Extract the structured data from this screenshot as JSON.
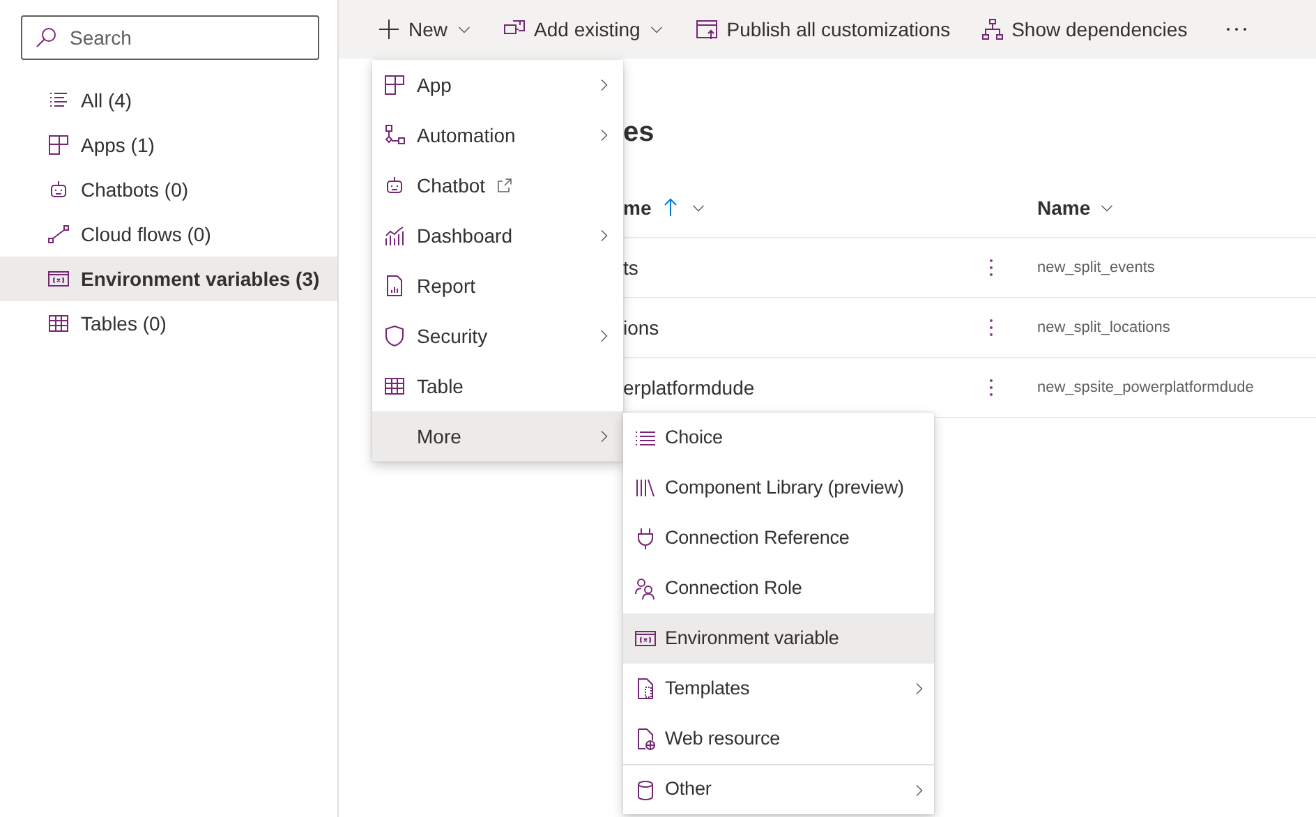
{
  "sidebar": {
    "search": {
      "placeholder": "Search"
    },
    "items": [
      {
        "label": "All (4)",
        "selected": false
      },
      {
        "label": "Apps (1)",
        "selected": false
      },
      {
        "label": "Chatbots (0)",
        "selected": false
      },
      {
        "label": "Cloud flows (0)",
        "selected": false
      },
      {
        "label": "Environment variables (3)",
        "selected": true
      },
      {
        "label": "Tables (0)",
        "selected": false
      }
    ]
  },
  "toolbar": {
    "items": [
      {
        "label": "New",
        "dropdown": true
      },
      {
        "label": "Add existing",
        "dropdown": true
      },
      {
        "label": "Publish all customizations",
        "dropdown": false
      },
      {
        "label": "Show dependencies",
        "dropdown": false
      }
    ]
  },
  "content": {
    "heading": "es",
    "columns": [
      {
        "label": "me",
        "sorted_ascending": true
      },
      {
        "label": "Name",
        "sorted_ascending": false
      }
    ],
    "rows": [
      {
        "column_1": "ts",
        "column_2": "new_split_events"
      },
      {
        "column_1": "ions",
        "column_2": "new_split_locations"
      },
      {
        "column_1": "erplatformdude",
        "column_2": "new_spsite_powerplatformdude"
      }
    ]
  },
  "new_menu": {
    "items": [
      {
        "label": "App",
        "submenu": true,
        "external": false,
        "selected": false
      },
      {
        "label": "Automation",
        "submenu": true,
        "external": false,
        "selected": false
      },
      {
        "label": "Chatbot",
        "submenu": false,
        "external": true,
        "selected": false
      },
      {
        "label": "Dashboard",
        "submenu": true,
        "external": false,
        "selected": false
      },
      {
        "label": "Report",
        "submenu": false,
        "external": false,
        "selected": false
      },
      {
        "label": "Security",
        "submenu": true,
        "external": false,
        "selected": false
      },
      {
        "label": "Table",
        "submenu": false,
        "external": false,
        "selected": false
      },
      {
        "label": "More",
        "submenu": true,
        "external": false,
        "selected": true
      }
    ]
  },
  "more_menu": {
    "items": [
      {
        "label": "Choice",
        "submenu": false,
        "separator_before": false,
        "selected": false
      },
      {
        "label": "Component Library (preview)",
        "submenu": false,
        "separator_before": false,
        "selected": false
      },
      {
        "label": "Connection Reference",
        "submenu": false,
        "separator_before": false,
        "selected": false
      },
      {
        "label": "Connection Role",
        "submenu": false,
        "separator_before": false,
        "selected": false
      },
      {
        "label": "Environment variable",
        "submenu": false,
        "separator_before": false,
        "selected": true
      },
      {
        "label": "Templates",
        "submenu": true,
        "separator_before": false,
        "selected": false
      },
      {
        "label": "Web resource",
        "submenu": false,
        "separator_before": false,
        "selected": false
      },
      {
        "label": "Other",
        "submenu": true,
        "separator_before": true,
        "selected": false
      }
    ]
  }
}
